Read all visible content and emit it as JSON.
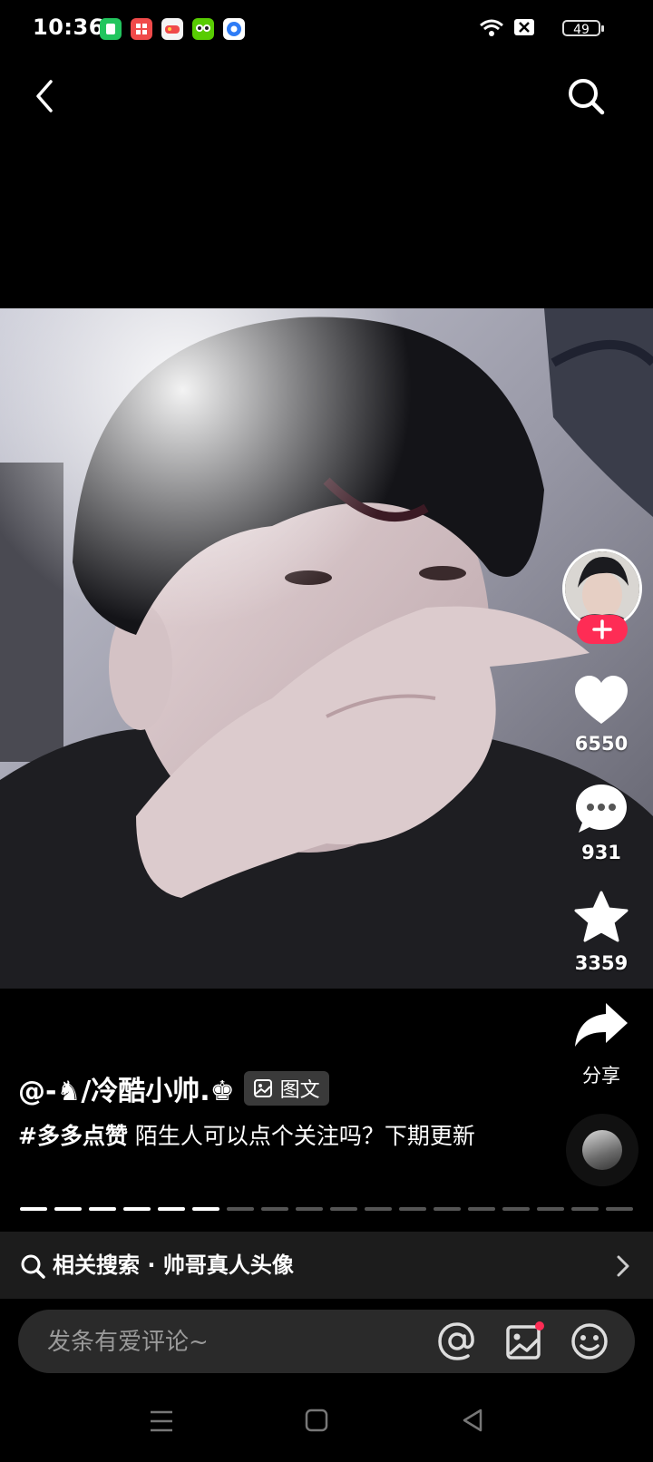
{
  "status_bar": {
    "time": "10:36",
    "battery": "49",
    "notification_apps": [
      {
        "name": "wechat-style-app-icon",
        "color": "#22c55e"
      },
      {
        "name": "grid-app-icon",
        "color": "#f04a4a"
      },
      {
        "name": "game-app-icon",
        "color": "#f5f5f5"
      },
      {
        "name": "duolingo-app-icon",
        "color": "#58cc02"
      },
      {
        "name": "browser-app-icon",
        "color": "#2e7cf6"
      }
    ]
  },
  "post": {
    "author": "@-♞/冷酷小帅.♚",
    "type_badge": "图文",
    "hashtag": "#多多点赞",
    "text": " 陌生人可以点个关注吗？下期更新",
    "image_progress": {
      "total": 18,
      "current": 6
    }
  },
  "actions": {
    "likes": "6550",
    "comments": "931",
    "favorites": "3359",
    "share_label": "分享"
  },
  "related_search": {
    "label": "相关搜索 · 帅哥真人头像"
  },
  "comment": {
    "placeholder": "发条有爱评论~"
  },
  "colors": {
    "accent": "#fe2c55",
    "background": "#000000"
  }
}
